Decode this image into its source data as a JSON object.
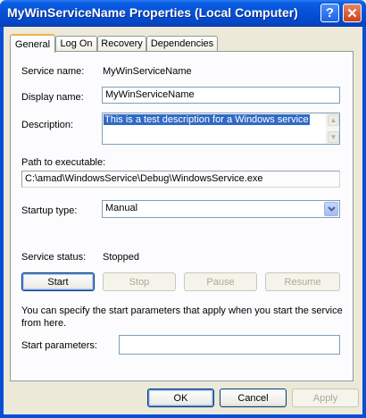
{
  "window": {
    "title": "MyWinServiceName Properties (Local Computer)",
    "help_glyph": "?",
    "close_glyph": "✕"
  },
  "tabs": [
    {
      "label": "General",
      "active": true
    },
    {
      "label": "Log On",
      "active": false
    },
    {
      "label": "Recovery",
      "active": false
    },
    {
      "label": "Dependencies",
      "active": false
    }
  ],
  "general": {
    "service_name_label": "Service name:",
    "service_name_value": "MyWinServiceName",
    "display_name_label": "Display name:",
    "display_name_value": "MyWinServiceName",
    "description_label": "Description:",
    "description_value": "This is a test description for a Windows service",
    "path_label": "Path to executable:",
    "path_value": "C:\\amad\\WindowsService\\Debug\\WindowsService.exe",
    "startup_type_label": "Startup type:",
    "startup_type_value": "Manual",
    "service_status_label": "Service status:",
    "service_status_value": "Stopped",
    "buttons": {
      "start": "Start",
      "stop": "Stop",
      "pause": "Pause",
      "resume": "Resume"
    },
    "help_text": "You can specify the start parameters that apply when you start the service from here.",
    "start_params_label": "Start parameters:",
    "start_params_value": ""
  },
  "footer": {
    "ok": "OK",
    "cancel": "Cancel",
    "apply": "Apply"
  },
  "colors": {
    "titlebar": "#0550d8",
    "selection": "#316ac5",
    "dialog_bg": "#ece9d8"
  }
}
